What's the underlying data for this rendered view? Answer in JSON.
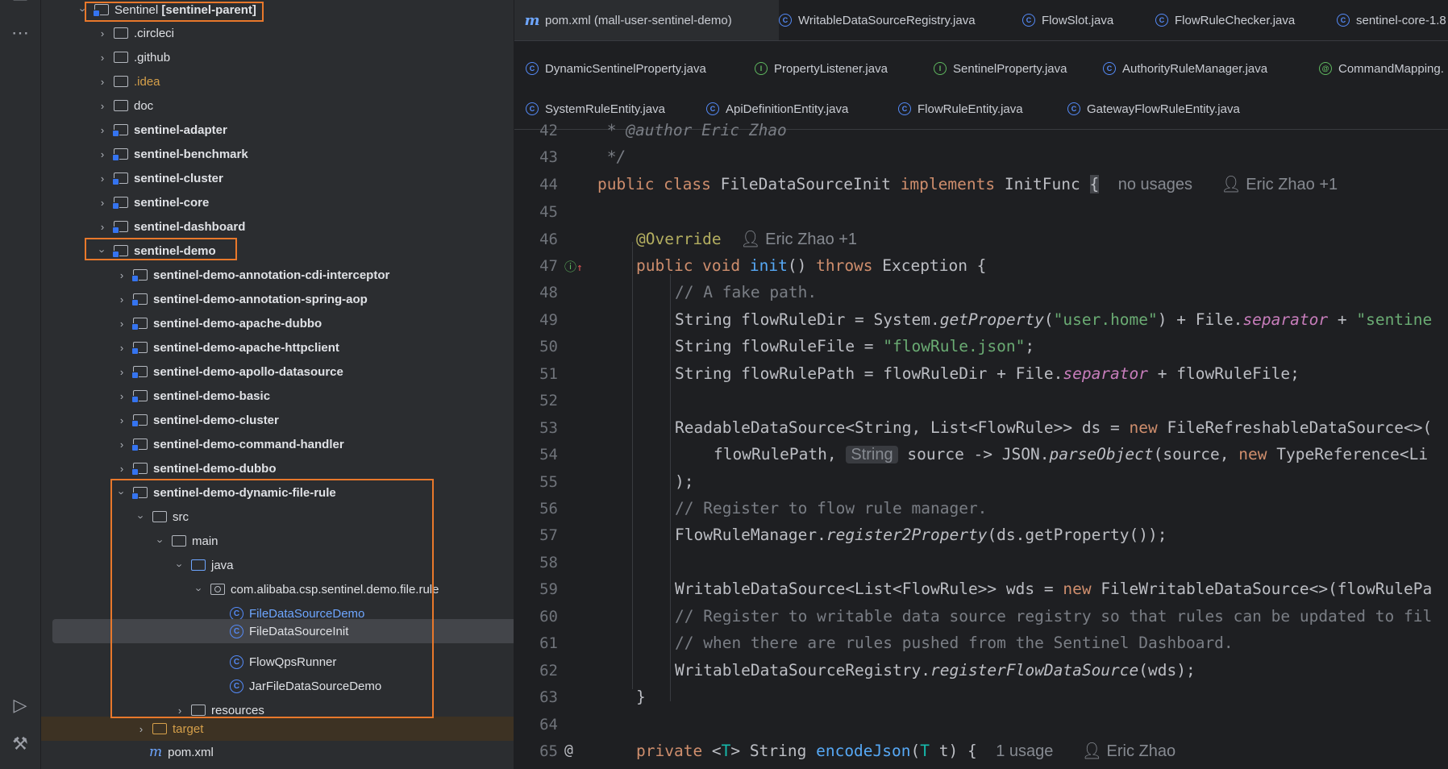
{
  "toolbar": {
    "icons": [
      "more-icon",
      "run-icon",
      "build-icon"
    ],
    "more_glyph": "⋯",
    "run_glyph": "▷",
    "build_glyph": "⚒"
  },
  "project_tree": {
    "root_label": "Sentinel",
    "root_module": "[sentinel-parent]",
    "items": [
      {
        "label": ".circleci"
      },
      {
        "label": ".github"
      },
      {
        "label": ".idea"
      },
      {
        "label": "doc"
      },
      {
        "label": "sentinel-adapter"
      },
      {
        "label": "sentinel-benchmark"
      },
      {
        "label": "sentinel-cluster"
      },
      {
        "label": "sentinel-core"
      },
      {
        "label": "sentinel-dashboard"
      },
      {
        "label": "sentinel-demo"
      },
      {
        "label": "sentinel-demo-annotation-cdi-interceptor"
      },
      {
        "label": "sentinel-demo-annotation-spring-aop"
      },
      {
        "label": "sentinel-demo-apache-dubbo"
      },
      {
        "label": "sentinel-demo-apache-httpclient"
      },
      {
        "label": "sentinel-demo-apollo-datasource"
      },
      {
        "label": "sentinel-demo-basic"
      },
      {
        "label": "sentinel-demo-cluster"
      },
      {
        "label": "sentinel-demo-command-handler"
      },
      {
        "label": "sentinel-demo-dubbo"
      },
      {
        "label": "sentinel-demo-dynamic-file-rule"
      },
      {
        "label": "src"
      },
      {
        "label": "main"
      },
      {
        "label": "java"
      },
      {
        "label": "com.alibaba.csp.sentinel.demo.file.rule"
      },
      {
        "label": "FileDataSourceDemo"
      },
      {
        "label": "FileDataSourceInit"
      },
      {
        "label": "FlowQpsRunner"
      },
      {
        "label": "JarFileDataSourceDemo"
      },
      {
        "label": "resources"
      },
      {
        "label": "target"
      },
      {
        "label": "pom.xml"
      }
    ]
  },
  "tabs": {
    "row1": [
      {
        "label": "pom.xml (mall-user-sentinel-demo)"
      },
      {
        "label": "WritableDataSourceRegistry.java"
      },
      {
        "label": "FlowSlot.java"
      },
      {
        "label": "FlowRuleChecker.java"
      },
      {
        "label": "sentinel-core-1.8"
      }
    ],
    "row2": [
      {
        "label": "DynamicSentinelProperty.java"
      },
      {
        "label": "PropertyListener.java"
      },
      {
        "label": "SentinelProperty.java"
      },
      {
        "label": "AuthorityRuleManager.java"
      },
      {
        "label": "CommandMapping."
      }
    ],
    "row3": [
      {
        "label": "SystemRuleEntity.java"
      },
      {
        "label": "ApiDefinitionEntity.java"
      },
      {
        "label": "FlowRuleEntity.java"
      },
      {
        "label": "GatewayFlowRuleEntity.java"
      }
    ]
  },
  "code": {
    "line_numbers": [
      "42",
      "43",
      "44",
      "45",
      "46",
      "47",
      "48",
      "49",
      "50",
      "51",
      "52",
      "53",
      "54",
      "55",
      "56",
      "57",
      "58",
      "59",
      "60",
      "61",
      "62",
      "63",
      "64",
      "65"
    ],
    "l42": " * @author Eric Zhao",
    "l43": " */",
    "l44": {
      "kw1": "public class ",
      "cls": "FileDataSourceInit ",
      "kw2": "implements ",
      "iface": "InitFunc ",
      "brace": "{",
      "hint1": "no usages",
      "hint2": "Eric Zhao +1"
    },
    "l46": {
      "ann": "@Override",
      "hint": "Eric Zhao +1"
    },
    "l47": {
      "kw1": "public void ",
      "fn": "init",
      "p": "() ",
      "kw2": "throws ",
      "rest": "Exception {"
    },
    "l48": "// A fake path.",
    "l49": {
      "a": "String flowRuleDir = System.",
      "m": "getProperty",
      "b": "(",
      "s1": "\"user.home\"",
      "c": ") + File.",
      "f": "separator",
      "d": " + ",
      "s2": "\"sentine"
    },
    "l50": {
      "a": "String flowRuleFile = ",
      "s": "\"flowRule.json\"",
      "b": ";"
    },
    "l51": {
      "a": "String flowRulePath = flowRuleDir + File.",
      "f": "separator",
      "b": " + flowRuleFile;"
    },
    "l53": {
      "a": "ReadableDataSource<String, List<FlowRule>> ds = ",
      "kw": "new ",
      "b": "FileRefreshableDataSource<>("
    },
    "l54": {
      "a": "flowRulePath, ",
      "inlay": "String",
      "b": " source -> JSON.",
      "m": "parseObject",
      "c": "(source, ",
      "kw": "new ",
      "d": "TypeReference<Li"
    },
    "l55": ");",
    "l56": "// Register to flow rule manager.",
    "l57": {
      "a": "FlowRuleManager.",
      "m": "register2Property",
      "b": "(ds.getProperty());"
    },
    "l59": {
      "a": "WritableDataSource<List<FlowRule>> wds = ",
      "kw": "new ",
      "b": "FileWritableDataSource<>(flowRulePa"
    },
    "l60": "// Register to writable data source registry so that rules can be updated to fil",
    "l61": "// when there are rules pushed from the Sentinel Dashboard.",
    "l62": {
      "a": "WritableDataSourceRegistry.",
      "m": "registerFlowDataSource",
      "b": "(wds);"
    },
    "l63": "}",
    "l65": {
      "kw": "private ",
      "a": "<",
      "tp": "T",
      "b": "> String ",
      "fn": "encodeJson",
      "c": "(",
      "tp2": "T",
      "d": " t) {",
      "hint1": "1 usage",
      "hint2": "Eric Zhao"
    }
  }
}
